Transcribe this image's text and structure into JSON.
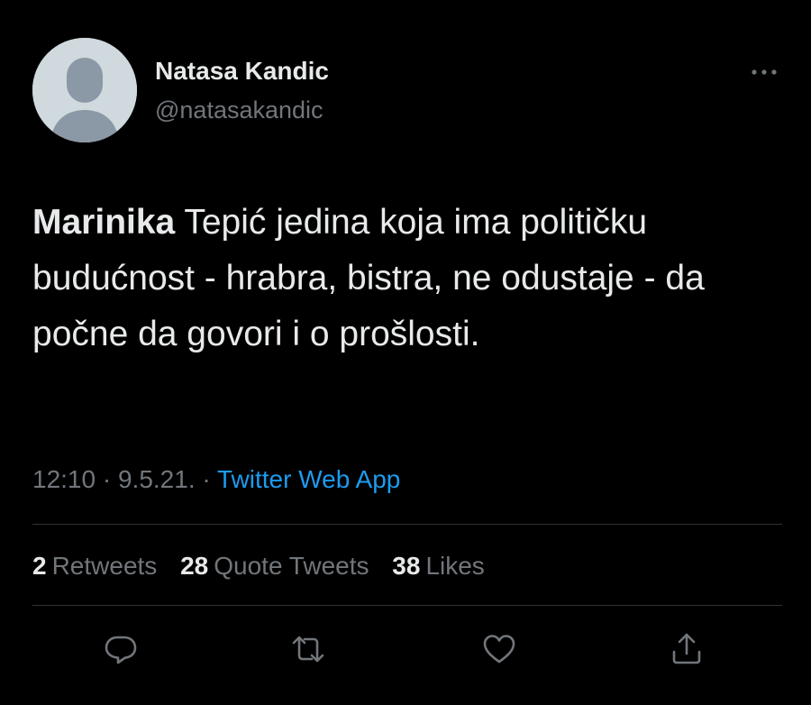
{
  "user": {
    "display_name": "Natasa Kandic",
    "handle": "@natasakandic"
  },
  "tweet": {
    "mention": "Marinika",
    "text": " Tepić jedina koja ima političku budućnost - hrabra, bistra, ne odustaje - da počne da govori i o prošlosti."
  },
  "meta": {
    "time": "12:10",
    "separator1": " · ",
    "date": "9.5.21.",
    "separator2": " · ",
    "source": "Twitter Web App"
  },
  "stats": {
    "retweets_count": "2",
    "retweets_label": "Retweets",
    "quotes_count": "28",
    "quotes_label": "Quote Tweets",
    "likes_count": "38",
    "likes_label": "Likes"
  },
  "icons": {
    "more": "more-icon",
    "reply": "reply-icon",
    "retweet": "retweet-icon",
    "like": "heart-icon",
    "share": "share-icon"
  },
  "colors": {
    "background": "#000000",
    "text": "#e7e9ea",
    "secondary": "#71767b",
    "accent": "#1d9bf0",
    "divider": "#2f3336",
    "avatar_bg": "#cfd9de",
    "avatar_fg": "#8b98a5"
  }
}
